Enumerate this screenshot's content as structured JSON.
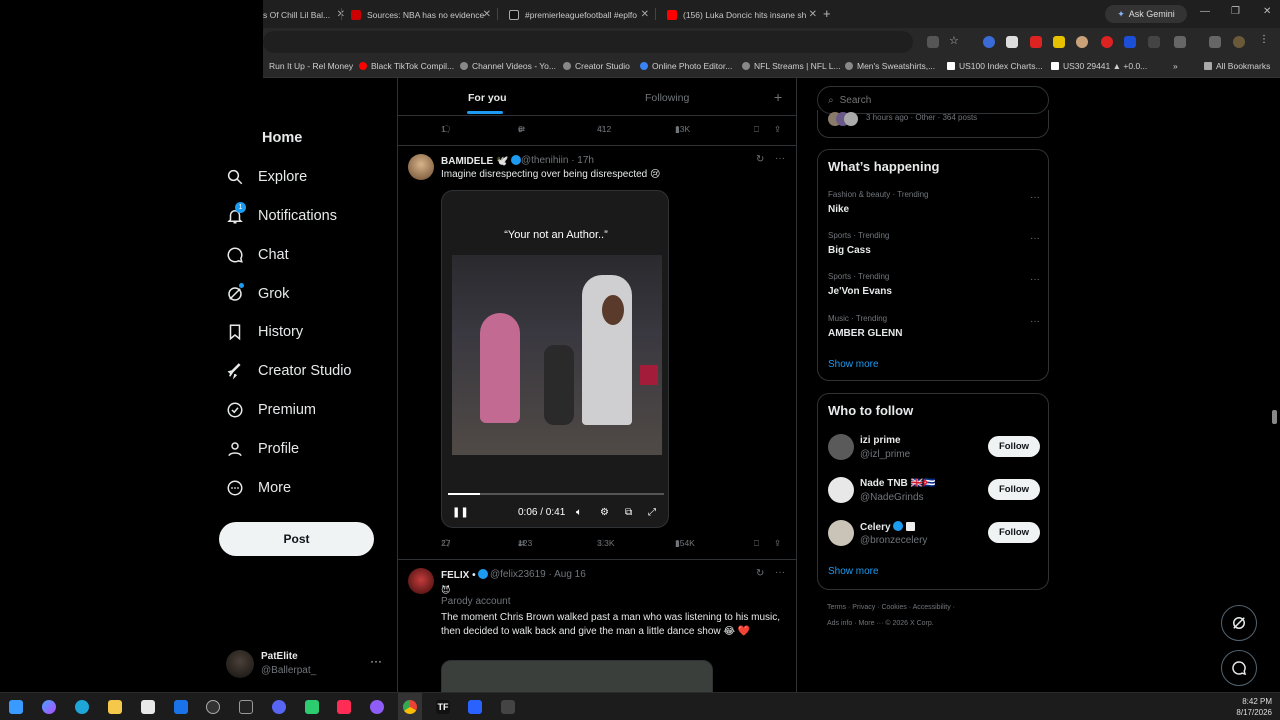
{
  "browser": {
    "tabs": [
      {
        "label": "s Of Chill Lil Bal...",
        "icon_color": "#ff0000"
      },
      {
        "label": "Sources: NBA has no evidence",
        "icon_color": "#cc0000"
      },
      {
        "label": "#premierleaguefootball #eplfo",
        "icon_color": "#ffffff"
      },
      {
        "label": "(156) Luka Doncic hits insane sh",
        "icon_color": "#ff0000"
      }
    ],
    "ask_gemini": "Ask Gemini",
    "bookmarks": [
      "Run It Up - Rel Money",
      "Black TikTok Compil...",
      "Channel Videos - Yo...",
      "Creator Studio",
      "Online Photo Editor...",
      "NFL Streams | NFL L...",
      "Men's Sweatshirts,...",
      "US100 Index Charts...",
      "US30 29441 ▲ +0.0...",
      "All Bookmarks"
    ]
  },
  "nav": {
    "items": [
      {
        "label": "Home",
        "icon": "home-icon"
      },
      {
        "label": "Explore",
        "icon": "search-icon"
      },
      {
        "label": "Notifications",
        "icon": "bell-icon",
        "badge": "1"
      },
      {
        "label": "Chat",
        "icon": "chat-icon"
      },
      {
        "label": "Grok",
        "icon": "grok-icon"
      },
      {
        "label": "History",
        "icon": "bookmark-icon"
      },
      {
        "label": "Creator Studio",
        "icon": "rocket-icon"
      },
      {
        "label": "Premium",
        "icon": "verified-icon"
      },
      {
        "label": "Profile",
        "icon": "person-icon"
      },
      {
        "label": "More",
        "icon": "more-circle-icon"
      }
    ],
    "post_label": "Post",
    "account": {
      "name": "PatElite",
      "handle": "@Ballerpat_"
    }
  },
  "feed": {
    "tabs": [
      "For you",
      "Following"
    ],
    "prev_actions": {
      "replies": "1",
      "reposts": "6",
      "likes": "412",
      "views": "13K"
    },
    "tweet1": {
      "name": "BAMIDELE 🕊️",
      "handle": "@thenihiin",
      "time": "· 17h",
      "text": "Imagine disrespecting over being disrespected 😢",
      "video_caption": "“Your not an Author..”",
      "video_time": "0:06 / 0:41",
      "progress": 0.146,
      "actions": {
        "replies": "27",
        "reposts": "123",
        "likes": "3.3K",
        "views": "154K"
      }
    },
    "tweet2": {
      "name": "FELIX •",
      "handle": "@felix23619",
      "time": "· Aug 16",
      "emoji_line": "😈",
      "parody": "Parody account",
      "text": "The moment Chris Brown walked past a man who was listening to his music, then decided to walk back and give the man a little dance show 😂 ❤️"
    }
  },
  "sidebar": {
    "search_placeholder": "Search",
    "prev_card_meta": "3 hours ago · Other · 364 posts",
    "happening_title": "What’s happening",
    "trends": [
      {
        "category": "Fashion & beauty · Trending",
        "name": "Nike"
      },
      {
        "category": "Sports · Trending",
        "name": "Big Cass"
      },
      {
        "category": "Sports · Trending",
        "name": "Je'Von Evans"
      },
      {
        "category": "Music · Trending",
        "name": "AMBER GLENN"
      }
    ],
    "show_more": "Show more",
    "follow_title": "Who to follow",
    "follow": [
      {
        "name": "izi prime",
        "handle": "@izl_prime",
        "avatar_color": "#5a5a5a"
      },
      {
        "name": "Nade TNB 🇬🇧🇨🇺",
        "handle": "@NadeGrinds",
        "avatar_color": "#e8e8e8"
      },
      {
        "name": "Celery",
        "handle": "@bronzecelery",
        "avatar_color": "#c9c3b8"
      }
    ],
    "follow_label": "Follow",
    "footer_line1": "Terms · Privacy · Cookies · Accessibility ·",
    "footer_line2": "Ads info · More ··· © 2026 X Corp."
  },
  "taskbar": {
    "time": "8:42 PM",
    "date": "8/17/2026"
  },
  "colors": {
    "accent": "#1d9bf0",
    "bg": "#000000",
    "border": "#2f3336",
    "muted": "#71767b"
  }
}
